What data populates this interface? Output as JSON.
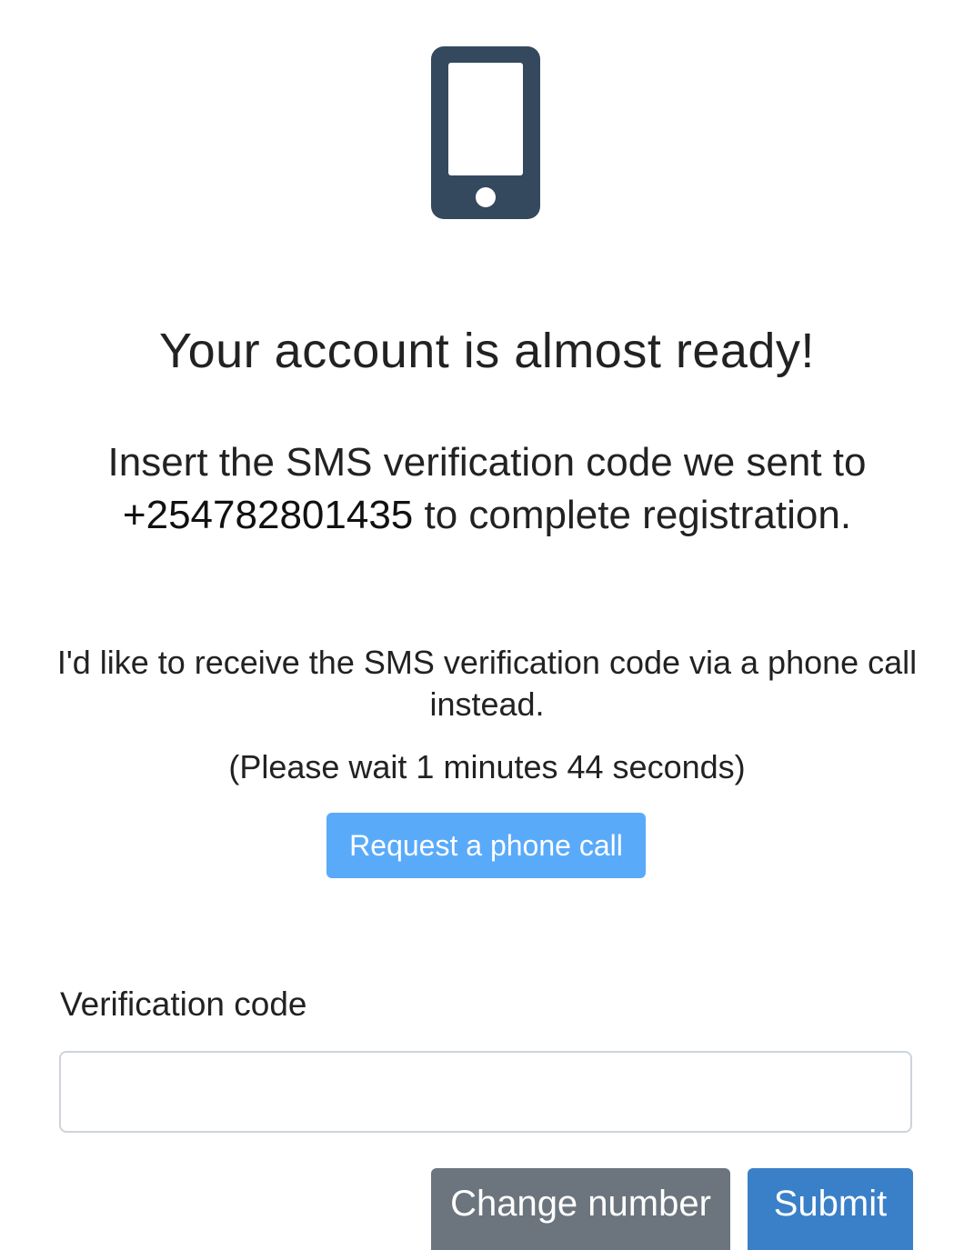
{
  "icons": {
    "phone": "mobile-phone-icon",
    "phone_color": "#34495e"
  },
  "title": "Your account is almost ready!",
  "instructions": {
    "before": "Insert the SMS verification code we sent to ",
    "phone_number": "+254782801435",
    "after": " to complete registration."
  },
  "call_option": {
    "text": "I'd like to receive the SMS verification code via a phone call instead.",
    "wait_text": "(Please wait 1 minutes 44 seconds)",
    "button_label": "Request a phone call",
    "button_color": "#5aaafa"
  },
  "form": {
    "code_label": "Verification code",
    "code_value": "",
    "code_placeholder": ""
  },
  "actions": {
    "change_number_label": "Change number",
    "change_number_color": "#6c757d",
    "submit_label": "Submit",
    "submit_color": "#3a80c8"
  }
}
